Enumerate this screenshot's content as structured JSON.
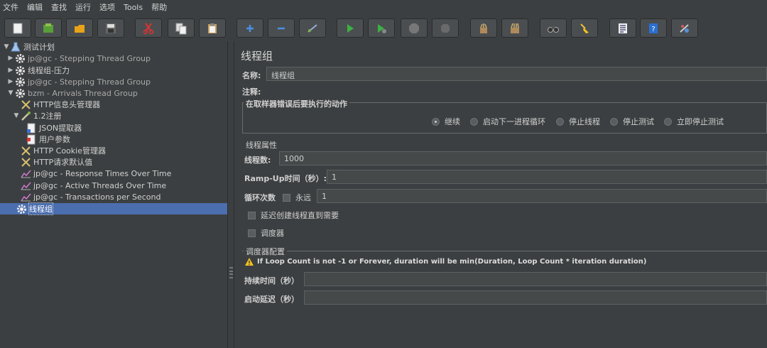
{
  "menu": [
    "文件",
    "编辑",
    "查找",
    "运行",
    "选项",
    "Tools",
    "帮助"
  ],
  "toolbar_icons": [
    "new-icon",
    "templates-icon",
    "open-icon",
    "save-icon",
    "cut-icon",
    "copy-icon",
    "paste-icon",
    "expand-icon",
    "collapse-icon",
    "toggle-icon",
    "start-icon",
    "start-no-pauses-icon",
    "stop-icon",
    "shutdown-icon",
    "clear-icon",
    "clear-all-icon",
    "search-icon",
    "reset-search-icon",
    "function-helper-icon",
    "help-icon",
    "remote-icon"
  ],
  "tree": {
    "items": [
      {
        "label": "测试计划",
        "icon": "flask-icon"
      },
      {
        "label": "jp@gc - Stepping Thread Group",
        "icon": "gear-icon"
      },
      {
        "label": "线程组-压力",
        "icon": "gear-icon"
      },
      {
        "label": "jp@gc - Stepping Thread Group",
        "icon": "gear-icon"
      },
      {
        "label": "bzm - Arrivals Thread Group",
        "icon": "gear-icon"
      },
      {
        "label": "HTTP信息头管理器",
        "icon": "tools-icon"
      },
      {
        "label": "1.2注册",
        "icon": "pipette-icon"
      },
      {
        "label": "JSON提取器",
        "icon": "document-icon"
      },
      {
        "label": "用户参数",
        "icon": "document-red-icon"
      },
      {
        "label": "HTTP Cookie管理器",
        "icon": "tools-icon"
      },
      {
        "label": "HTTP请求默认值",
        "icon": "tools-icon"
      },
      {
        "label": "jp@gc - Response Times Over Time",
        "icon": "chart-icon"
      },
      {
        "label": "jp@gc - Active Threads Over Time",
        "icon": "chart-icon"
      },
      {
        "label": "jp@gc - Transactions per Second",
        "icon": "chart-icon"
      },
      {
        "label": "线程组",
        "icon": "gear-icon"
      }
    ]
  },
  "panel": {
    "title": "线程组",
    "name_label": "名称:",
    "name_value": "线程组",
    "comment_label": "注释:",
    "error_group_title": "在取样器错误后要执行的动作",
    "error_actions": [
      "继续",
      "启动下一进程循环",
      "停止线程",
      "停止测试",
      "立即停止测试"
    ],
    "thread_props_title": "线程属性",
    "threads_label": "线程数:",
    "threads_value": "1000",
    "rampup_label": "Ramp-Up时间（秒）:",
    "rampup_value": "1",
    "loop_label": "循环次数",
    "forever_label": "永远",
    "loop_value": "1",
    "delay_label": "延迟创建线程直到需要",
    "scheduler_label": "调度器",
    "scheduler_config_title": "调度器配置",
    "warning_text": "If Loop Count is not -1 or Forever, duration will be min(Duration, Loop Count * iteration duration)",
    "duration_label": "持续时间（秒）",
    "startup_delay_label": "启动延迟（秒）"
  }
}
